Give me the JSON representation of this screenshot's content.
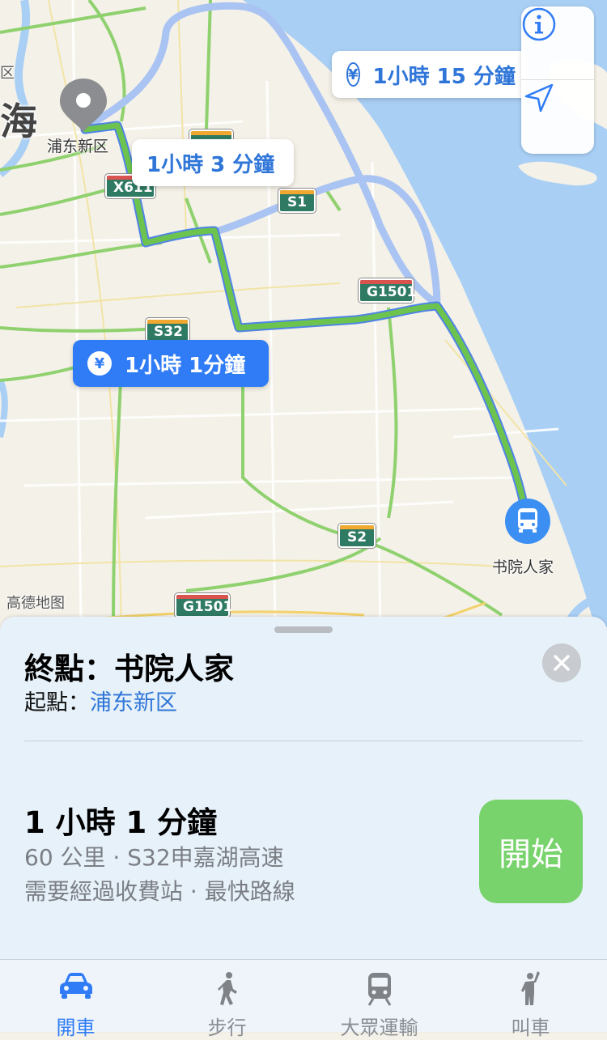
{
  "map": {
    "labels": {
      "shanghai_partial": "海",
      "district_partial": "区",
      "origin_label": "浦东新区",
      "destination_label": "书院人家",
      "attribution": "高德地图"
    },
    "shields": [
      "X611",
      "S1",
      "G1501",
      "S32",
      "S2",
      "G1501"
    ],
    "routes": {
      "alt_route_1": {
        "duration": "1小時 15 分鐘",
        "toll": "¥"
      },
      "alt_route_2": {
        "duration": "1小時 3 分鐘"
      },
      "main_route": {
        "duration": "1小時 1分鐘",
        "toll": "¥"
      }
    },
    "controls": {
      "info_icon": "info-icon",
      "locate_icon": "location-arrow-icon"
    }
  },
  "sheet": {
    "destination_prefix": "終點：",
    "destination": "书院人家",
    "origin_prefix": "起點：",
    "origin": "浦东新区",
    "duration": "1 小時 1 分鐘",
    "distance_road": "60 公里 · S32申嘉湖高速",
    "notes": "需要經過收費站 · 最快路線",
    "start_label": "開始"
  },
  "tabs": [
    {
      "label": "開車",
      "icon": "car-icon",
      "active": true
    },
    {
      "label": "步行",
      "icon": "walk-icon",
      "active": false
    },
    {
      "label": "大眾運輸",
      "icon": "train-icon",
      "active": false
    },
    {
      "label": "叫車",
      "icon": "hail-icon",
      "active": false
    }
  ],
  "colors": {
    "accent": "#2f7cf6",
    "route_green": "#6cc34d",
    "route_alt": "#a9c3f2",
    "start_button": "#78d36c",
    "water": "#a9cff5",
    "land": "#f4f1e8"
  }
}
